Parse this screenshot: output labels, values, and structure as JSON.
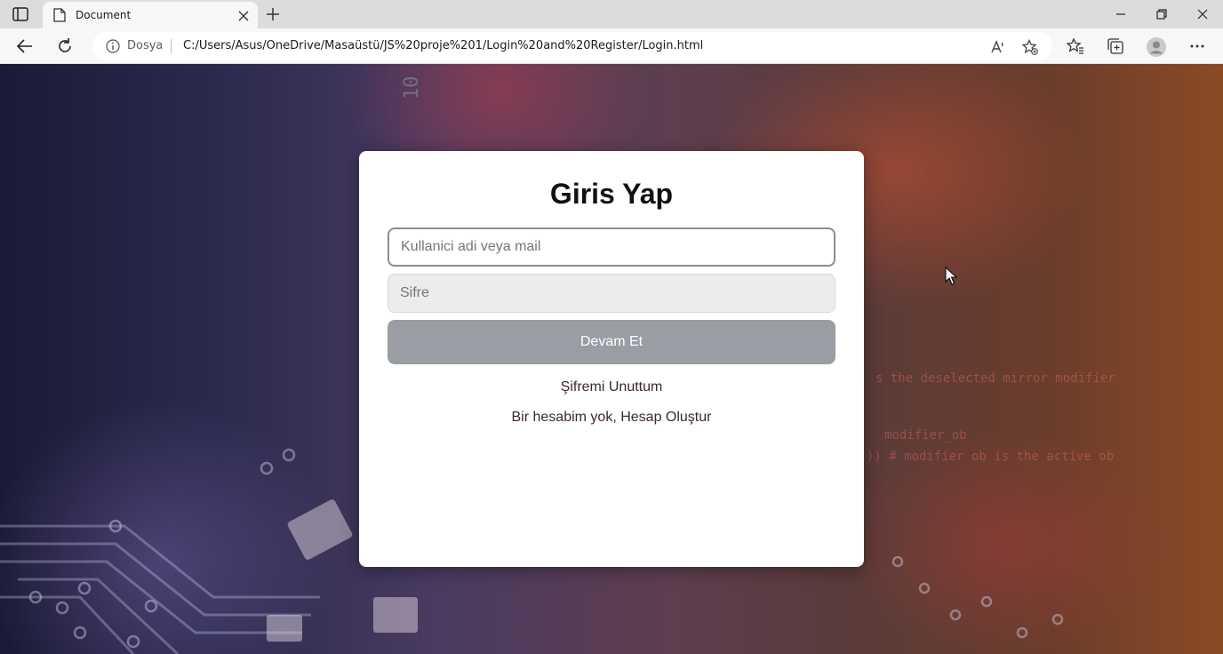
{
  "browser": {
    "tab_title": "Document",
    "site_label": "Dosya",
    "url": "C:/Users/Asus/OneDrive/Masaüstü/JS%20proje%201/Login%20and%20Register/Login.html",
    "icons": [
      "tab-actions-icon",
      "page-icon",
      "close-icon",
      "plus-icon",
      "minimize-icon",
      "maximize-icon",
      "close-window-icon",
      "back-icon",
      "reload-icon",
      "info-icon",
      "read-aloud-icon",
      "add-favorite-icon",
      "favorites-icon",
      "collections-icon",
      "profile-icon",
      "more-icon"
    ]
  },
  "login": {
    "title": "Giris Yap",
    "username_placeholder": "Kullanici adi veya mail",
    "password_placeholder": "Sifre",
    "submit_label": "Devam Et",
    "forgot_link": "Şifremi Unuttum",
    "register_link": "Bir hesabim yok, Hesap Oluştur"
  },
  "colors": {
    "submit_bg": "#9a9ea4",
    "card_bg": "#ffffff",
    "link_text": "#3b2a2a"
  }
}
